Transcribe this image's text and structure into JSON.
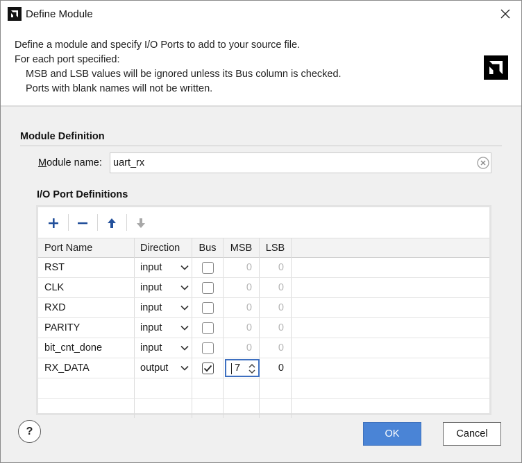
{
  "window": {
    "title": "Define Module",
    "app_icon": "amd-logo-icon",
    "close_icon": "close-icon"
  },
  "header": {
    "line1": "Define a module and specify I/O Ports to add to your source file.",
    "line2": "For each port specified:",
    "line3": "MSB and LSB values will be ignored unless its Bus column is checked.",
    "line4": "Ports with blank names will not be written.",
    "logo": "amd-logo-icon"
  },
  "module_definition": {
    "title": "Module Definition",
    "name_label_accel": "M",
    "name_label_rest": "odule name:",
    "name_value": "uart_rx"
  },
  "io_ports": {
    "title": "I/O Port Definitions",
    "toolbar": {
      "add_icon": "plus-icon",
      "remove_icon": "minus-icon",
      "move_up_icon": "arrow-up-icon",
      "move_down_icon": "arrow-down-icon"
    },
    "columns": [
      "Port Name",
      "Direction",
      "Bus",
      "MSB",
      "LSB"
    ],
    "rows": [
      {
        "name": "RST",
        "direction": "input",
        "bus": false,
        "msb": "0",
        "lsb": "0"
      },
      {
        "name": "CLK",
        "direction": "input",
        "bus": false,
        "msb": "0",
        "lsb": "0"
      },
      {
        "name": "RXD",
        "direction": "input",
        "bus": false,
        "msb": "0",
        "lsb": "0"
      },
      {
        "name": "PARITY",
        "direction": "input",
        "bus": false,
        "msb": "0",
        "lsb": "0"
      },
      {
        "name": "bit_cnt_done",
        "direction": "input",
        "bus": false,
        "msb": "0",
        "lsb": "0"
      },
      {
        "name": "RX_DATA",
        "direction": "output",
        "bus": true,
        "msb": "7",
        "lsb": "0"
      }
    ]
  },
  "footer": {
    "help_label": "?",
    "ok_label": "OK",
    "cancel_label": "Cancel"
  },
  "colors": {
    "accent": "#4a84d6",
    "focus_border": "#3d6fc0"
  }
}
